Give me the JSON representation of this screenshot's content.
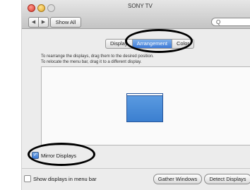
{
  "window": {
    "title": "SONY TV"
  },
  "toolbar": {
    "back_icon": "◀",
    "forward_icon": "▶",
    "show_all_label": "Show All",
    "search_icon": "Q"
  },
  "tabs": [
    {
      "label": "Display",
      "active": false
    },
    {
      "label": "Arrangement",
      "active": true
    },
    {
      "label": "Color",
      "active": false
    }
  ],
  "instructions": {
    "line1": "To rearrange the displays, drag them to the desired position.",
    "line2": "To relocate the menu bar, drag it to a different display."
  },
  "mirror": {
    "label": "Mirror Displays",
    "checked": true,
    "check_glyph": "✓"
  },
  "bottom": {
    "show_in_menu_bar_label": "Show displays in menu bar",
    "gather_windows_label": "Gather Windows",
    "detect_displays_label": "Detect Displays"
  },
  "colors": {
    "accent": "#3b78d6",
    "display_fill": "#4a8ad8",
    "annotation_ring": "#000000"
  }
}
